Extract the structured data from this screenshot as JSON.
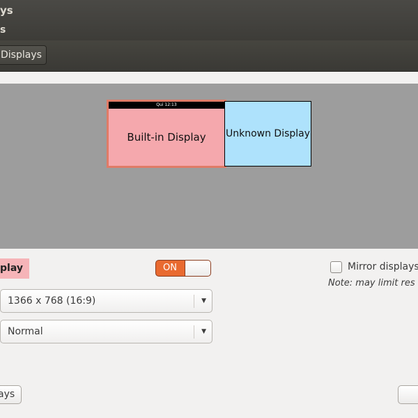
{
  "window": {
    "title": "ys",
    "subtitle": "s"
  },
  "toolbar": {
    "breadcrumb_label": "Displays"
  },
  "arrangement": {
    "monitors": [
      {
        "label": "Built-in Display",
        "panel_clock": "Qui 12:13",
        "color": "#f5a8ad",
        "selected": true
      },
      {
        "label": "Unknown Display",
        "color": "#aee2fc",
        "selected": false
      }
    ]
  },
  "settings": {
    "display_name": "play",
    "power_switch": {
      "label": "ON",
      "state": "on"
    },
    "resolution": {
      "value": "1366 x 768 (16:9)"
    },
    "rotation": {
      "value": "Normal"
    },
    "mirror": {
      "label": "Mirror displays",
      "checked": false,
      "note": "Note: may limit res"
    }
  },
  "buttons": {
    "left_label": "ays",
    "right_label": ""
  },
  "colors": {
    "accent": "#e96a30",
    "titlebar": "#3d3c38",
    "background": "#f2f1f0",
    "arrangement_bg": "#9d9d9d"
  }
}
